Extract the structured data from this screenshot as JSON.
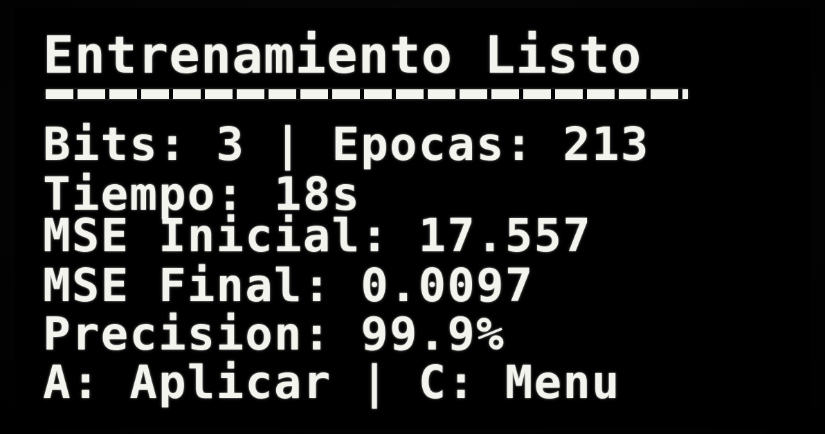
{
  "display": {
    "title": "Entrenamiento Listo",
    "line_bits_epocas": "Bits: 3 | Epocas: 213",
    "line_tiempo": "Tiempo: 18s",
    "line_mse_inicial": "MSE Inicial: 17.557",
    "line_mse_final": "MSE Final: 0.0097",
    "line_precision": "Precision: 99.9%",
    "line_actions": "A: Aplicar | C: Menu"
  },
  "colors": {
    "background": "#000000",
    "text": "#f4f4ee"
  }
}
